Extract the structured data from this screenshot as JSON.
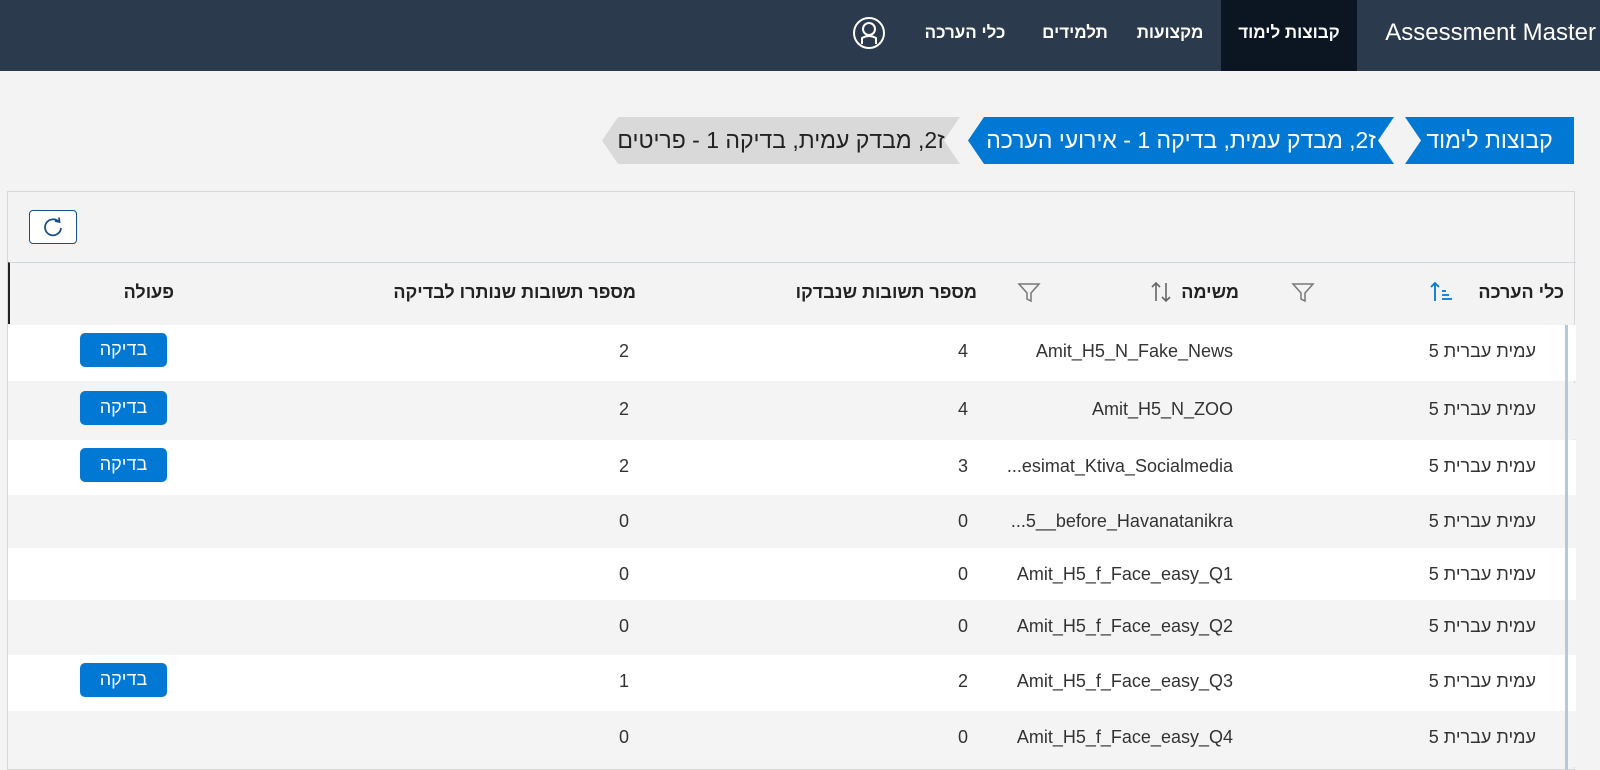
{
  "app": {
    "title": "Assessment Master"
  },
  "nav": {
    "items": [
      {
        "label": "קבוצות לימוד",
        "active": true
      },
      {
        "label": "מקצועות"
      },
      {
        "label": "תלמידים"
      },
      {
        "label": "כלי הערכה"
      }
    ],
    "user_icon": "user-circle-icon"
  },
  "breadcrumb": [
    {
      "label": "קבוצות לימוד"
    },
    {
      "label": "ז2, מבדק עמית, בדיקה 1 - אירועי הערכה"
    },
    {
      "label": "ז2, מבדק עמית, בדיקה 1 - פריטים"
    }
  ],
  "toolbar": {
    "refresh_icon": "refresh-icon"
  },
  "table": {
    "columns": {
      "tool": "כלי הערכה",
      "task": "משימה",
      "checked": "מספר תשובות שנבדקו",
      "remaining": "מספר תשובות שנותרו לבדיקה",
      "action": "פעולה"
    },
    "action_label": "בדיקה",
    "rows": [
      {
        "tool": "עמית עברית 5",
        "task": "Amit_H5_N_Fake_News",
        "checked": "4",
        "remaining": "2",
        "has_action": true
      },
      {
        "tool": "עמית עברית 5",
        "task": "Amit_H5_N_ZOO",
        "checked": "4",
        "remaining": "2",
        "has_action": true
      },
      {
        "tool": "עמית עברית 5",
        "task": "...esimat_Ktiva_Socialmedia",
        "checked": "3",
        "remaining": "2",
        "has_action": true
      },
      {
        "tool": "עמית עברית 5",
        "task": "...5__before_Havanatanikra",
        "checked": "0",
        "remaining": "0",
        "has_action": false
      },
      {
        "tool": "עמית עברית 5",
        "task": "Amit_H5_f_Face_easy_Q1",
        "checked": "0",
        "remaining": "0",
        "has_action": false
      },
      {
        "tool": "עמית עברית 5",
        "task": "Amit_H5_f_Face_easy_Q2",
        "checked": "0",
        "remaining": "0",
        "has_action": false
      },
      {
        "tool": "עמית עברית 5",
        "task": "Amit_H5_f_Face_easy_Q3",
        "checked": "2",
        "remaining": "1",
        "has_action": true
      },
      {
        "tool": "עמית עברית 5",
        "task": "Amit_H5_f_Face_easy_Q4",
        "checked": "0",
        "remaining": "0",
        "has_action": false
      }
    ]
  },
  "colors": {
    "nav_bg": "#2c3a4e",
    "nav_active": "#0c1623",
    "accent": "#0078d4"
  }
}
